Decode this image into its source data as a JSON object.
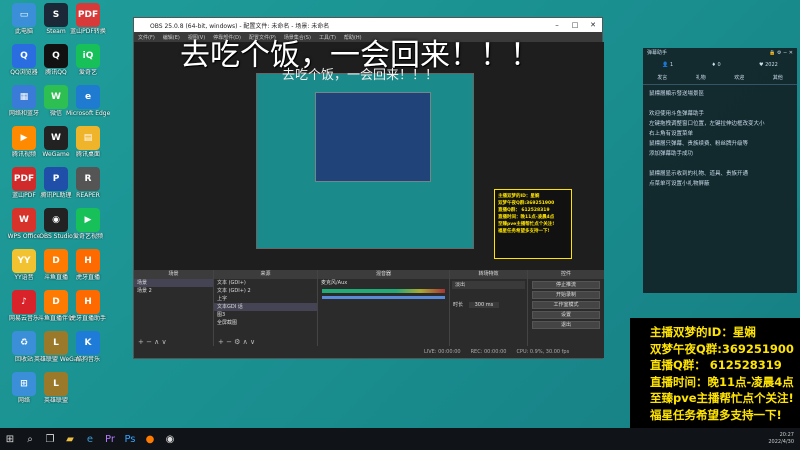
{
  "desktop": {
    "icons": [
      {
        "label": "此电脑",
        "color": "#3a8fd8",
        "glyph": "▭"
      },
      {
        "label": "Steam",
        "color": "#1b2838",
        "glyph": "S"
      },
      {
        "label": "蓝山PDF转换",
        "color": "#d83a3a",
        "glyph": "PDF"
      },
      {
        "label": "QQ浏览器",
        "color": "#2a6de0",
        "glyph": "Q"
      },
      {
        "label": "腾讯QQ",
        "color": "#111",
        "glyph": "Q"
      },
      {
        "label": "爱奇艺",
        "color": "#18c05a",
        "glyph": "iQ"
      },
      {
        "label": "网络和蓝牙",
        "color": "#3b7bd8",
        "glyph": "▦"
      },
      {
        "label": "微信",
        "color": "#2dbf51",
        "glyph": "W"
      },
      {
        "label": "Microsoft Edge",
        "color": "#1f7bd0",
        "glyph": "e"
      },
      {
        "label": "腾讯视频",
        "color": "#ff8a00",
        "glyph": "▶"
      },
      {
        "label": "WeGame",
        "color": "#222",
        "glyph": "W"
      },
      {
        "label": "腾讯桌面",
        "color": "#f0b42a",
        "glyph": "▤"
      },
      {
        "label": "蓝山PDF",
        "color": "#d02a2a",
        "glyph": "PDF"
      },
      {
        "label": "腾讯PL助理",
        "color": "#1f4fa8",
        "glyph": "P"
      },
      {
        "label": "REAPER",
        "color": "#555",
        "glyph": "R"
      },
      {
        "label": "WPS Office",
        "color": "#d8332a",
        "glyph": "W"
      },
      {
        "label": "OBS Studio",
        "color": "#222",
        "glyph": "◉"
      },
      {
        "label": "爱奇艺视频",
        "color": "#18c05a",
        "glyph": "▶"
      },
      {
        "label": "YY语音",
        "color": "#f2c230",
        "glyph": "YY"
      },
      {
        "label": "斗鱼直播",
        "color": "#ff7a00",
        "glyph": "D"
      },
      {
        "label": "虎牙直播",
        "color": "#ff6a00",
        "glyph": "H"
      },
      {
        "label": "网易云音乐",
        "color": "#d8232a",
        "glyph": "♪"
      },
      {
        "label": "斗鱼直播伴侣",
        "color": "#ff7a00",
        "glyph": "D"
      },
      {
        "label": "虎牙直播助手",
        "color": "#ff6a00",
        "glyph": "H"
      },
      {
        "label": "回收站",
        "color": "#3a8fd8",
        "glyph": "♻"
      },
      {
        "label": "英雄联盟 WeGame版",
        "color": "#9a7a2a",
        "glyph": "L"
      },
      {
        "label": "酷狗音乐",
        "color": "#1f7bd8",
        "glyph": "K"
      },
      {
        "label": "网络",
        "color": "#3a8fd8",
        "glyph": "⊞"
      },
      {
        "label": "英雄联盟",
        "color": "#9a7a2a",
        "glyph": "L"
      }
    ]
  },
  "obs": {
    "title": "OBS 25.0.8 (64-bit, windows) - 配置文件: 未命名 - 场景: 未命名",
    "menu": [
      "文件(F)",
      "编辑(E)",
      "视图(V)",
      "停靠部件(D)",
      "配置文件(P)",
      "场景集合(S)",
      "工具(T)",
      "帮助(H)"
    ],
    "docks": {
      "scenes": {
        "title": "场景",
        "items": [
          "场景",
          "场景 2"
        ]
      },
      "sources": {
        "title": "来源",
        "items": [
          "文本 (GDI+)",
          "文本 (GDI+) 2",
          "上字",
          "文本GDI 话",
          "图3",
          "全屏截图"
        ]
      },
      "mixer": {
        "title": "混音器",
        "items": [
          "麦克风/Aux",
          "桌面音频"
        ]
      },
      "transitions": {
        "title": "转场特效",
        "selected": "淡出",
        "duration_label": "时长",
        "duration": "300 ms"
      },
      "controls": {
        "title": "控件",
        "buttons": [
          "停止推流",
          "开始录制",
          "工作室模式",
          "设置",
          "退出"
        ]
      }
    },
    "status": [
      "LIVE: 00:00:00",
      "REC: 00:00:00",
      "CPU: 0.9%, 30.00 fps"
    ]
  },
  "overlay": {
    "title": "去吃个饭，一会回来！！！",
    "title_echo": "去吃个饭，一会回来！！！"
  },
  "chat_panel": {
    "header": "弹幕助手",
    "stats": [
      "1",
      "0",
      "2022"
    ],
    "tabs": [
      "发言",
      "礼物",
      "欢迎",
      "其他"
    ],
    "messages": [
      "鼠標層顯示發送場景區",
      "欢迎使用斗鱼弹幕助手",
      "左键拖拽调整窗口位置，左键拉伸边框改变大小",
      "右上角有设置菜单",
      "鼠標層只弹幕、贵族续费、粉丝牌升级等",
      "添加弹幕助手成功",
      "鼠標層显示收到的礼物、道具、贵族开通",
      "点菜单可设置小礼物屏蔽"
    ]
  },
  "info_box": {
    "lines": [
      "主播双梦的ID：星娴",
      "双梦午夜Q群:369251900",
      "直播Q群： 612528319",
      "直播时间：晚11点-凌晨4点",
      "至臻pve主播帮忙点个关注!",
      "福星任务希望多支持一下!"
    ]
  },
  "taskbar": {
    "time": "20:27",
    "date": "2022/4/30"
  }
}
